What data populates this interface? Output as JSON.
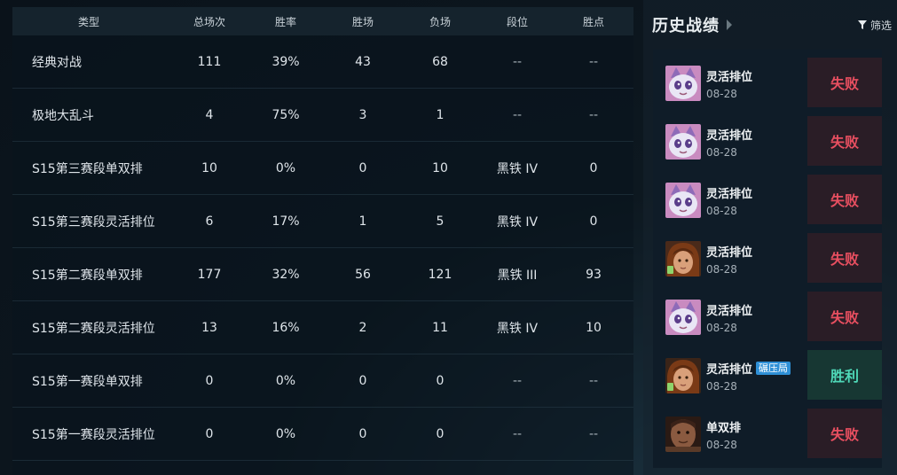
{
  "table": {
    "headers": {
      "type": "类型",
      "total": "总场次",
      "rate": "胜率",
      "wins": "胜场",
      "losses": "负场",
      "tier": "段位",
      "lp": "胜点"
    },
    "rows": [
      {
        "type": "经典对战",
        "total": "111",
        "rate": "39%",
        "wins": "43",
        "losses": "68",
        "tier": "--",
        "lp": "--"
      },
      {
        "type": "极地大乱斗",
        "total": "4",
        "rate": "75%",
        "wins": "3",
        "losses": "1",
        "tier": "--",
        "lp": "--"
      },
      {
        "type": "S15第三赛段单双排",
        "total": "10",
        "rate": "0%",
        "wins": "0",
        "losses": "10",
        "tier": "黑铁 IV",
        "lp": "0"
      },
      {
        "type": "S15第三赛段灵活排位",
        "total": "6",
        "rate": "17%",
        "wins": "1",
        "losses": "5",
        "tier": "黑铁 IV",
        "lp": "0"
      },
      {
        "type": "S15第二赛段单双排",
        "total": "177",
        "rate": "32%",
        "wins": "56",
        "losses": "121",
        "tier": "黑铁 III",
        "lp": "93"
      },
      {
        "type": "S15第二赛段灵活排位",
        "total": "13",
        "rate": "16%",
        "wins": "2",
        "losses": "11",
        "tier": "黑铁 IV",
        "lp": "10"
      },
      {
        "type": "S15第一赛段单双排",
        "total": "0",
        "rate": "0%",
        "wins": "0",
        "losses": "0",
        "tier": "--",
        "lp": "--"
      },
      {
        "type": "S15第一赛段灵活排位",
        "total": "0",
        "rate": "0%",
        "wins": "0",
        "losses": "0",
        "tier": "--",
        "lp": "--"
      }
    ]
  },
  "history": {
    "title": "历史战绩",
    "filter_label": "筛选",
    "matches": [
      {
        "mode": "灵活排位",
        "tag": "",
        "date": "08-28",
        "result": "失败",
        "outcome": "lose",
        "avatar": "cat-icon"
      },
      {
        "mode": "灵活排位",
        "tag": "",
        "date": "08-28",
        "result": "失败",
        "outcome": "lose",
        "avatar": "cat-icon"
      },
      {
        "mode": "灵活排位",
        "tag": "",
        "date": "08-28",
        "result": "失败",
        "outcome": "lose",
        "avatar": "cat-icon"
      },
      {
        "mode": "灵活排位",
        "tag": "",
        "date": "08-28",
        "result": "失败",
        "outcome": "lose",
        "avatar": "champion-girl-icon"
      },
      {
        "mode": "灵活排位",
        "tag": "",
        "date": "08-28",
        "result": "失败",
        "outcome": "lose",
        "avatar": "cat-icon"
      },
      {
        "mode": "灵活排位",
        "tag": "碾压局",
        "date": "08-28",
        "result": "胜利",
        "outcome": "win",
        "avatar": "champion-girl-icon"
      },
      {
        "mode": "单双排",
        "tag": "",
        "date": "08-28",
        "result": "失败",
        "outcome": "lose",
        "avatar": "champion-man-icon"
      }
    ]
  },
  "colors": {
    "lose_text": "#e84f60",
    "win_text": "#4fd9b8",
    "tag_bg": "#2e8fd6"
  }
}
